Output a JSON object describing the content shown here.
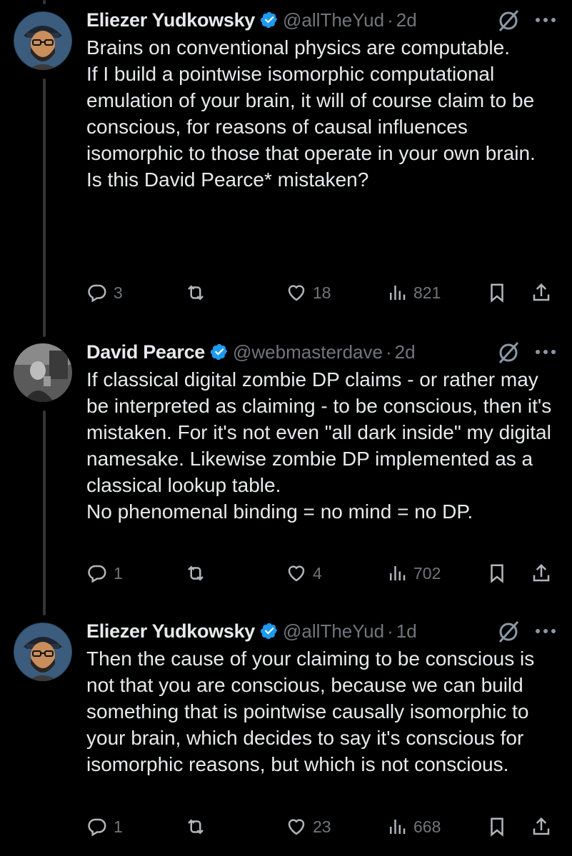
{
  "colors": {
    "background": "#000000",
    "text": "#e7e9ea",
    "muted": "#71767b",
    "verified": "#1d9bf0",
    "thread_line": "#333639"
  },
  "tweets": [
    {
      "author": "Eliezer Yudkowsky",
      "handle": "@allTheYud",
      "separator": "·",
      "time": "2d",
      "avatar": "cartoon-man-with-hat-avatar",
      "text": [
        "Brains on conventional physics are computable.",
        "",
        "If I build a pointwise isomorphic computational emulation of your brain, it will of course claim to be conscious, for reasons of causal influences isomorphic to those that operate in your own brain.",
        "",
        "Is this David Pearce* mistaken?"
      ],
      "replies": "3",
      "retweets": "",
      "likes": "18",
      "views": "821"
    },
    {
      "author": "David Pearce",
      "handle": "@webmasterdave",
      "separator": "·",
      "time": "2d",
      "avatar": "grayscale-photo-avatar",
      "text": [
        "If classical digital zombie DP claims - or rather may be interpreted as claiming - to be conscious, then it's mistaken. For it's not even \"all dark inside\" my digital namesake. Likewise zombie DP implemented as a classical lookup table.",
        "No phenomenal binding = no mind = no DP."
      ],
      "replies": "1",
      "retweets": "",
      "likes": "4",
      "views": "702"
    },
    {
      "author": "Eliezer Yudkowsky",
      "handle": "@allTheYud",
      "separator": "·",
      "time": "1d",
      "avatar": "cartoon-man-with-hat-avatar",
      "text": [
        "Then the cause of your claiming to be conscious is not that you are conscious, because we can build something that is pointwise causally isomorphic to your brain, which decides to say it's conscious for isomorphic reasons, but which is not conscious."
      ],
      "replies": "1",
      "retweets": "",
      "likes": "23",
      "views": "668"
    }
  ],
  "icons": [
    "verified-badge-icon",
    "grok-icon",
    "more-icon",
    "reply-icon",
    "retweet-icon",
    "like-icon",
    "views-icon",
    "bookmark-icon",
    "share-icon"
  ]
}
